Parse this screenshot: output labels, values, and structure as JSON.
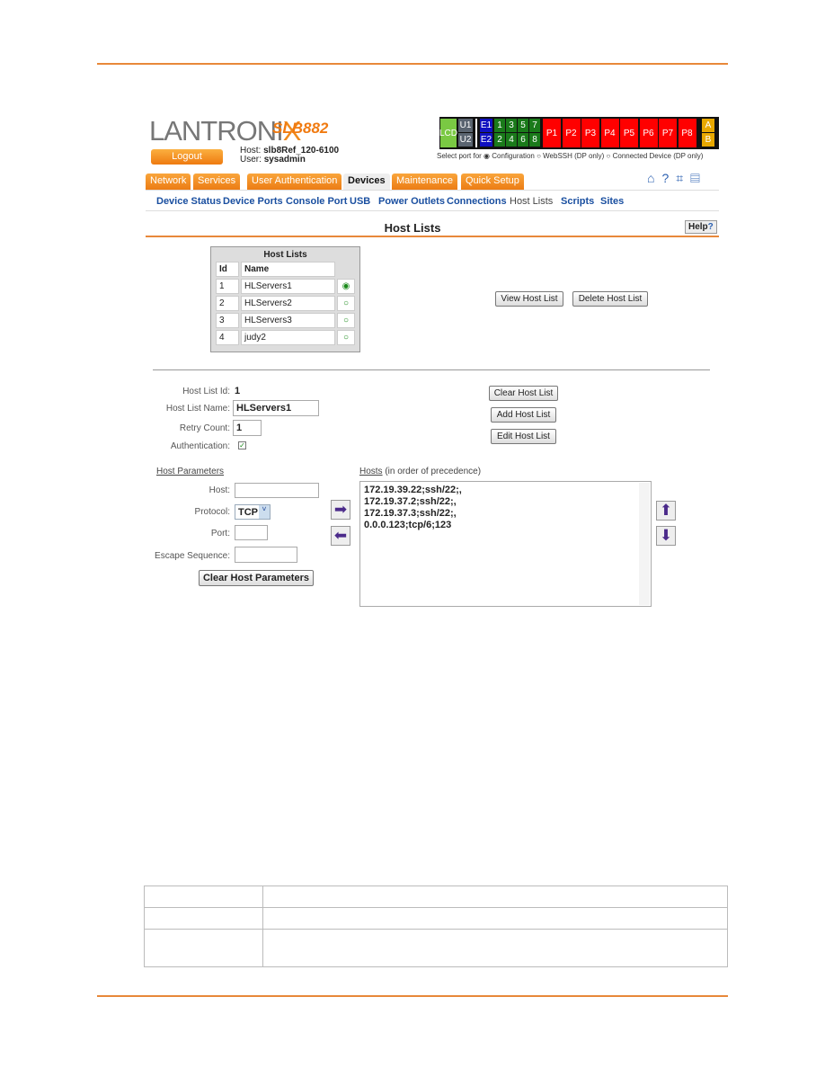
{
  "brand": {
    "logo": "LANTRONIX",
    "model": "SLB882"
  },
  "header": {
    "logout": "Logout",
    "host_label": "Host:",
    "host": "slb8Ref_120-6100",
    "user_label": "User:",
    "user": "sysadmin"
  },
  "ports": {
    "lcd": "LCD",
    "u": [
      "U1",
      "U2"
    ],
    "e": [
      "E1",
      "E2"
    ],
    "top": [
      "1",
      "3",
      "5",
      "7"
    ],
    "bottom": [
      "2",
      "4",
      "6",
      "8"
    ],
    "p": [
      "P1",
      "P2",
      "P3",
      "P4",
      "P5",
      "P6",
      "P7",
      "P8"
    ],
    "ab": [
      "A",
      "B"
    ],
    "select_label": "Select port for",
    "options": [
      "Configuration",
      "WebSSH (DP only)",
      "Connected Device (DP only)"
    ],
    "selected": "Configuration",
    "colors": {
      "lcd": "#7ac943",
      "u": "#5a6470",
      "e": "#1010c0",
      "num": "#1a7a1a",
      "p": "#ff0000",
      "ab": "#e8a800"
    }
  },
  "tabs": [
    "Network",
    "Services",
    "User Authentication",
    "Devices",
    "Maintenance",
    "Quick Setup"
  ],
  "active_tab": "Devices",
  "toolbar_icons": [
    "home-icon",
    "help-icon",
    "network-icon",
    "log-icon"
  ],
  "subnav": [
    "Device Status",
    "Device Ports",
    "Console Port",
    "USB",
    "Power Outlets",
    "Connections",
    "Host Lists",
    "Scripts",
    "Sites"
  ],
  "page_title": "Host Lists",
  "help": "Help",
  "hostlists": {
    "title": "Host Lists",
    "col_id": "Id",
    "col_name": "Name",
    "rows": [
      {
        "id": "1",
        "name": "HLServers1",
        "selected": true
      },
      {
        "id": "2",
        "name": "HLServers2"
      },
      {
        "id": "3",
        "name": "HLServers3"
      },
      {
        "id": "4",
        "name": "judy2"
      }
    ],
    "view": "View Host List",
    "delete": "Delete Host List"
  },
  "form": {
    "id_label": "Host List Id:",
    "id": "1",
    "name_label": "Host List Name:",
    "name": "HLServers1",
    "retry_label": "Retry Count:",
    "retry": "1",
    "auth_label": "Authentication:",
    "auth": true,
    "clear": "Clear Host List",
    "add": "Add Host List",
    "edit": "Edit Host List"
  },
  "params": {
    "title": "Host Parameters",
    "host_label": "Host:",
    "protocol_label": "Protocol:",
    "protocol": "TCP",
    "port_label": "Port:",
    "escape_label": "Escape Sequence:",
    "clear": "Clear Host Parameters"
  },
  "hosts": {
    "title": "Hosts",
    "subtitle": "(in order of precedence)",
    "items": [
      "172.19.39.22;ssh/22;,",
      "172.19.37.2;ssh/22;,",
      "172.19.37.3;ssh/22;,",
      "0.0.0.123;tcp/6;123"
    ]
  }
}
